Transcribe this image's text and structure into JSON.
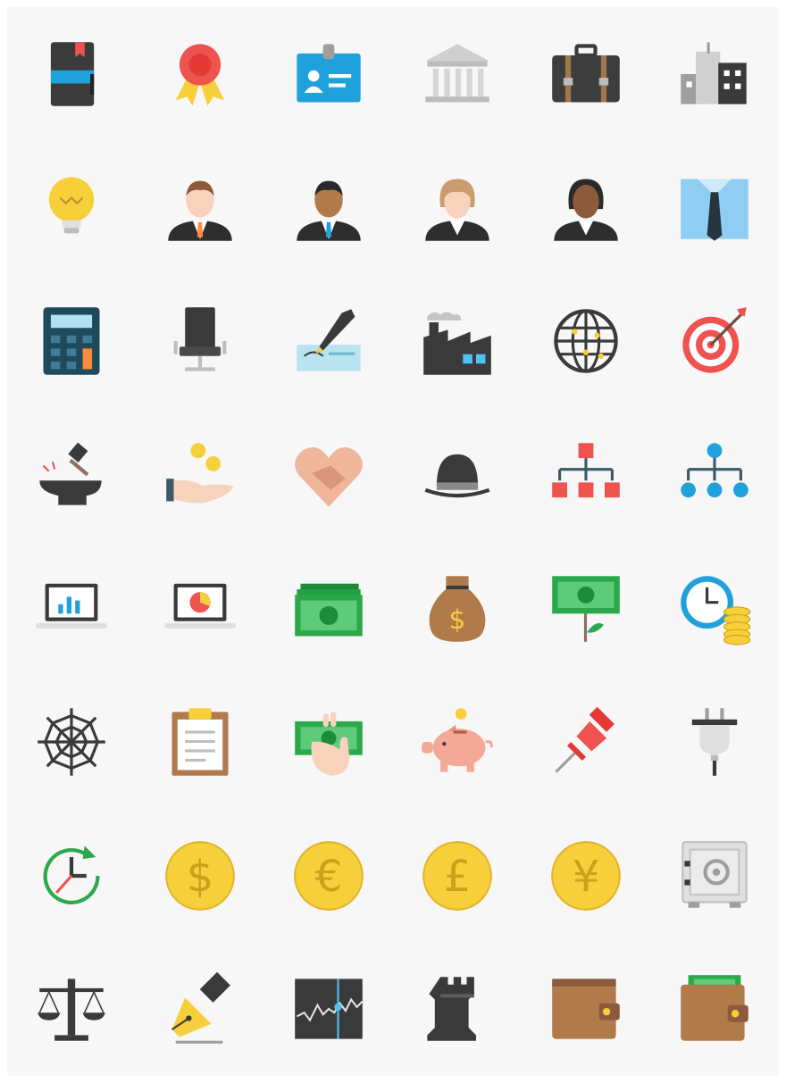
{
  "colors": {
    "background": "#f7f7f7",
    "dark": "#3a3a3a",
    "blue": "#1fa2dc",
    "green": "#2aa84a",
    "gold": "#f6cf3a",
    "red": "#ef5350",
    "brown": "#b07a4a",
    "skin": "#f7d2bd"
  },
  "icons": [
    {
      "row": 1,
      "name": "notebook-icon"
    },
    {
      "row": 1,
      "name": "award-ribbon-icon"
    },
    {
      "row": 1,
      "name": "id-badge-icon"
    },
    {
      "row": 1,
      "name": "bank-building-icon"
    },
    {
      "row": 1,
      "name": "briefcase-icon"
    },
    {
      "row": 1,
      "name": "city-buildings-icon"
    },
    {
      "row": 2,
      "name": "lightbulb-icon"
    },
    {
      "row": 2,
      "name": "businessman-icon"
    },
    {
      "row": 2,
      "name": "businessman-dark-icon"
    },
    {
      "row": 2,
      "name": "businesswoman-icon"
    },
    {
      "row": 2,
      "name": "businesswoman-dark-icon"
    },
    {
      "row": 2,
      "name": "shirt-tie-icon"
    },
    {
      "row": 3,
      "name": "calculator-icon"
    },
    {
      "row": 3,
      "name": "office-chair-icon"
    },
    {
      "row": 3,
      "name": "signing-check-icon"
    },
    {
      "row": 3,
      "name": "factory-icon"
    },
    {
      "row": 3,
      "name": "globe-network-icon"
    },
    {
      "row": 3,
      "name": "target-arrow-icon"
    },
    {
      "row": 4,
      "name": "anvil-hammer-icon"
    },
    {
      "row": 4,
      "name": "hand-coins-icon"
    },
    {
      "row": 4,
      "name": "handshake-heart-icon"
    },
    {
      "row": 4,
      "name": "bowler-hat-icon"
    },
    {
      "row": 4,
      "name": "org-chart-squares-icon"
    },
    {
      "row": 4,
      "name": "org-chart-circles-icon"
    },
    {
      "row": 5,
      "name": "laptop-bar-chart-icon"
    },
    {
      "row": 5,
      "name": "laptop-pie-chart-icon"
    },
    {
      "row": 5,
      "name": "cash-stack-icon"
    },
    {
      "row": 5,
      "name": "money-bag-icon"
    },
    {
      "row": 5,
      "name": "money-plant-icon"
    },
    {
      "row": 5,
      "name": "clock-coins-icon"
    },
    {
      "row": 6,
      "name": "spider-web-icon"
    },
    {
      "row": 6,
      "name": "clipboard-icon"
    },
    {
      "row": 6,
      "name": "hand-cash-icon"
    },
    {
      "row": 6,
      "name": "piggy-bank-icon"
    },
    {
      "row": 6,
      "name": "push-pin-icon"
    },
    {
      "row": 6,
      "name": "power-plug-icon"
    },
    {
      "row": 7,
      "name": "clock-refresh-icon"
    },
    {
      "row": 7,
      "name": "dollar-coin-icon",
      "symbol": "$"
    },
    {
      "row": 7,
      "name": "euro-coin-icon",
      "symbol": "€"
    },
    {
      "row": 7,
      "name": "pound-coin-icon",
      "symbol": "£"
    },
    {
      "row": 7,
      "name": "yen-coin-icon",
      "symbol": "¥"
    },
    {
      "row": 7,
      "name": "safe-icon"
    },
    {
      "row": 8,
      "name": "scales-icon"
    },
    {
      "row": 8,
      "name": "fountain-pen-icon"
    },
    {
      "row": 8,
      "name": "stock-chart-icon"
    },
    {
      "row": 8,
      "name": "chess-rook-icon"
    },
    {
      "row": 8,
      "name": "wallet-icon"
    },
    {
      "row": 8,
      "name": "wallet-cash-icon"
    }
  ]
}
